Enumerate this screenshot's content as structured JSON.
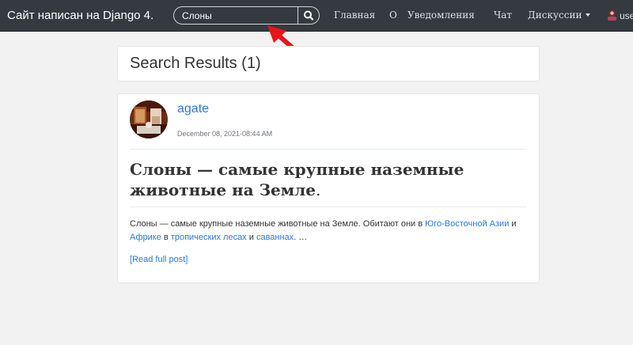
{
  "navbar": {
    "brand": "Сайт написан на Django 4.",
    "search": {
      "value": "Слоны",
      "icon": "search-icon"
    },
    "links": {
      "home": "Главная",
      "about": "О",
      "notifications": "Уведомления",
      "chat": "Чат",
      "discussions": "Дискуссии"
    },
    "user": {
      "label": "use"
    }
  },
  "annotation": {
    "arrow_color": "#e8141b"
  },
  "results": {
    "title": "Search Results (1)"
  },
  "post": {
    "author": "agate",
    "date": "December 08, 2021-08:44 AM",
    "title": "Слоны — самые крупные наземные животные на Земле",
    "title_end": ".",
    "excerpt": {
      "t1": "Слоны — самые крупные наземные животные на Земле. Обитают они в ",
      "l1": "Юго-Восточной Азии",
      "t2": " и ",
      "l2": "Африке",
      "t3": " в ",
      "l3": "тропических лесах",
      "t4": " и ",
      "l4": "саваннах",
      "t5": ". …"
    },
    "read_more": "[Read full post]"
  },
  "colors": {
    "navbar": "#343a40",
    "link": "#2a7ae2",
    "background": "#f2f2f2"
  }
}
